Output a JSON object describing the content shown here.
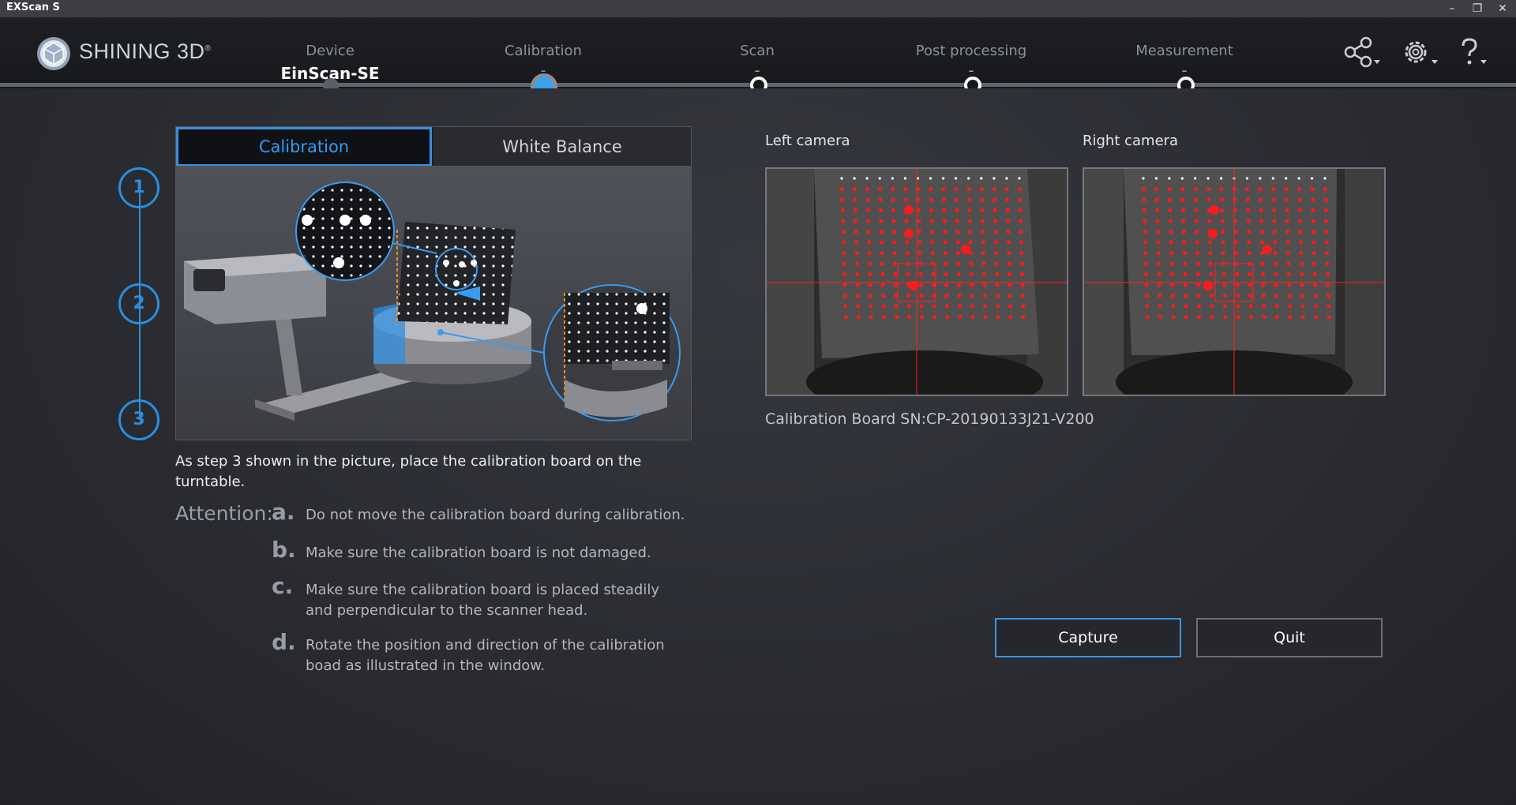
{
  "window": {
    "title": "EXScan S"
  },
  "brand": {
    "name": "SHINING 3D",
    "mark": "®"
  },
  "steps": [
    {
      "label": "Device",
      "value": "EinScan-SE"
    },
    {
      "label": "Calibration",
      "value": "-"
    },
    {
      "label": "Scan",
      "value": "-"
    },
    {
      "label": "Post processing",
      "value": "-"
    },
    {
      "label": "Measurement",
      "value": "-"
    }
  ],
  "header_icons": [
    "share-icon",
    "settings-icon",
    "help-icon"
  ],
  "tabs": {
    "calibration": "Calibration",
    "white_balance": "White Balance"
  },
  "step_numbers": [
    "1",
    "2",
    "3"
  ],
  "instruction": "As step 3 shown in the picture, place the calibration board on the turntable.",
  "attention": {
    "title": "Attention:",
    "items": [
      {
        "letter": "a.",
        "text": "Do not move the calibration board during calibration."
      },
      {
        "letter": "b.",
        "text": "Make sure the calibration board is not damaged."
      },
      {
        "letter": "c.",
        "text": "Make sure the calibration board is placed steadily and perpendicular to the scanner head."
      },
      {
        "letter": "d.",
        "text": "Rotate the position and direction of the calibration boad as illustrated in the window."
      }
    ]
  },
  "cameras": {
    "left": "Left camera",
    "right": "Right camera"
  },
  "calibration_board_sn": "Calibration Board SN:CP-20190133J21-V200",
  "buttons": {
    "capture": "Capture",
    "quit": "Quit"
  },
  "colors": {
    "accent": "#2f9cf4",
    "dot": "#ff1a1a",
    "background": "#2a2c33"
  }
}
